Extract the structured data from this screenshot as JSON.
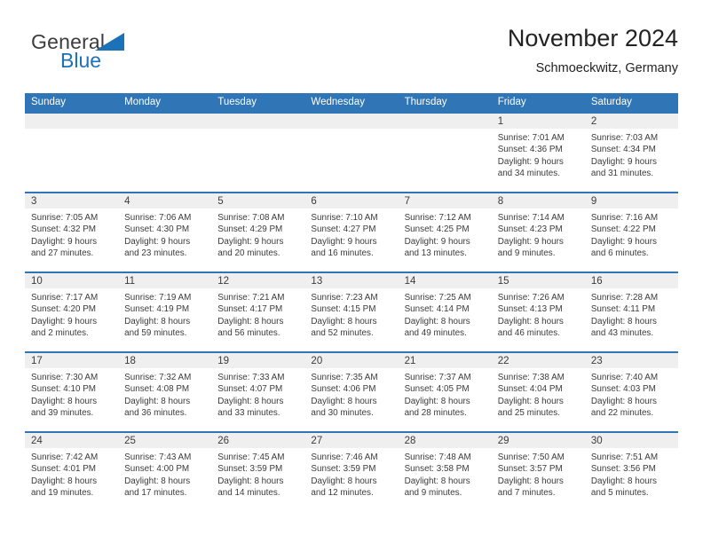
{
  "brand": {
    "word_one": "General",
    "word_two": "Blue",
    "triangle_color": "#1b72b8",
    "text_color": "#3c3c3c"
  },
  "header": {
    "title": "November 2024",
    "subtitle": "Schmoeckwitz, Germany",
    "accent_color": "#3075b5",
    "daynum_band_color": "#efefef"
  },
  "calendar": {
    "weekdays": [
      "Sunday",
      "Monday",
      "Tuesday",
      "Wednesday",
      "Thursday",
      "Friday",
      "Saturday"
    ],
    "weeks": [
      [
        {
          "day": "",
          "lines": []
        },
        {
          "day": "",
          "lines": []
        },
        {
          "day": "",
          "lines": []
        },
        {
          "day": "",
          "lines": []
        },
        {
          "day": "",
          "lines": []
        },
        {
          "day": "1",
          "lines": [
            "Sunrise: 7:01 AM",
            "Sunset: 4:36 PM",
            "Daylight: 9 hours",
            "and 34 minutes."
          ]
        },
        {
          "day": "2",
          "lines": [
            "Sunrise: 7:03 AM",
            "Sunset: 4:34 PM",
            "Daylight: 9 hours",
            "and 31 minutes."
          ]
        }
      ],
      [
        {
          "day": "3",
          "lines": [
            "Sunrise: 7:05 AM",
            "Sunset: 4:32 PM",
            "Daylight: 9 hours",
            "and 27 minutes."
          ]
        },
        {
          "day": "4",
          "lines": [
            "Sunrise: 7:06 AM",
            "Sunset: 4:30 PM",
            "Daylight: 9 hours",
            "and 23 minutes."
          ]
        },
        {
          "day": "5",
          "lines": [
            "Sunrise: 7:08 AM",
            "Sunset: 4:29 PM",
            "Daylight: 9 hours",
            "and 20 minutes."
          ]
        },
        {
          "day": "6",
          "lines": [
            "Sunrise: 7:10 AM",
            "Sunset: 4:27 PM",
            "Daylight: 9 hours",
            "and 16 minutes."
          ]
        },
        {
          "day": "7",
          "lines": [
            "Sunrise: 7:12 AM",
            "Sunset: 4:25 PM",
            "Daylight: 9 hours",
            "and 13 minutes."
          ]
        },
        {
          "day": "8",
          "lines": [
            "Sunrise: 7:14 AM",
            "Sunset: 4:23 PM",
            "Daylight: 9 hours",
            "and 9 minutes."
          ]
        },
        {
          "day": "9",
          "lines": [
            "Sunrise: 7:16 AM",
            "Sunset: 4:22 PM",
            "Daylight: 9 hours",
            "and 6 minutes."
          ]
        }
      ],
      [
        {
          "day": "10",
          "lines": [
            "Sunrise: 7:17 AM",
            "Sunset: 4:20 PM",
            "Daylight: 9 hours",
            "and 2 minutes."
          ]
        },
        {
          "day": "11",
          "lines": [
            "Sunrise: 7:19 AM",
            "Sunset: 4:19 PM",
            "Daylight: 8 hours",
            "and 59 minutes."
          ]
        },
        {
          "day": "12",
          "lines": [
            "Sunrise: 7:21 AM",
            "Sunset: 4:17 PM",
            "Daylight: 8 hours",
            "and 56 minutes."
          ]
        },
        {
          "day": "13",
          "lines": [
            "Sunrise: 7:23 AM",
            "Sunset: 4:15 PM",
            "Daylight: 8 hours",
            "and 52 minutes."
          ]
        },
        {
          "day": "14",
          "lines": [
            "Sunrise: 7:25 AM",
            "Sunset: 4:14 PM",
            "Daylight: 8 hours",
            "and 49 minutes."
          ]
        },
        {
          "day": "15",
          "lines": [
            "Sunrise: 7:26 AM",
            "Sunset: 4:13 PM",
            "Daylight: 8 hours",
            "and 46 minutes."
          ]
        },
        {
          "day": "16",
          "lines": [
            "Sunrise: 7:28 AM",
            "Sunset: 4:11 PM",
            "Daylight: 8 hours",
            "and 43 minutes."
          ]
        }
      ],
      [
        {
          "day": "17",
          "lines": [
            "Sunrise: 7:30 AM",
            "Sunset: 4:10 PM",
            "Daylight: 8 hours",
            "and 39 minutes."
          ]
        },
        {
          "day": "18",
          "lines": [
            "Sunrise: 7:32 AM",
            "Sunset: 4:08 PM",
            "Daylight: 8 hours",
            "and 36 minutes."
          ]
        },
        {
          "day": "19",
          "lines": [
            "Sunrise: 7:33 AM",
            "Sunset: 4:07 PM",
            "Daylight: 8 hours",
            "and 33 minutes."
          ]
        },
        {
          "day": "20",
          "lines": [
            "Sunrise: 7:35 AM",
            "Sunset: 4:06 PM",
            "Daylight: 8 hours",
            "and 30 minutes."
          ]
        },
        {
          "day": "21",
          "lines": [
            "Sunrise: 7:37 AM",
            "Sunset: 4:05 PM",
            "Daylight: 8 hours",
            "and 28 minutes."
          ]
        },
        {
          "day": "22",
          "lines": [
            "Sunrise: 7:38 AM",
            "Sunset: 4:04 PM",
            "Daylight: 8 hours",
            "and 25 minutes."
          ]
        },
        {
          "day": "23",
          "lines": [
            "Sunrise: 7:40 AM",
            "Sunset: 4:03 PM",
            "Daylight: 8 hours",
            "and 22 minutes."
          ]
        }
      ],
      [
        {
          "day": "24",
          "lines": [
            "Sunrise: 7:42 AM",
            "Sunset: 4:01 PM",
            "Daylight: 8 hours",
            "and 19 minutes."
          ]
        },
        {
          "day": "25",
          "lines": [
            "Sunrise: 7:43 AM",
            "Sunset: 4:00 PM",
            "Daylight: 8 hours",
            "and 17 minutes."
          ]
        },
        {
          "day": "26",
          "lines": [
            "Sunrise: 7:45 AM",
            "Sunset: 3:59 PM",
            "Daylight: 8 hours",
            "and 14 minutes."
          ]
        },
        {
          "day": "27",
          "lines": [
            "Sunrise: 7:46 AM",
            "Sunset: 3:59 PM",
            "Daylight: 8 hours",
            "and 12 minutes."
          ]
        },
        {
          "day": "28",
          "lines": [
            "Sunrise: 7:48 AM",
            "Sunset: 3:58 PM",
            "Daylight: 8 hours",
            "and 9 minutes."
          ]
        },
        {
          "day": "29",
          "lines": [
            "Sunrise: 7:50 AM",
            "Sunset: 3:57 PM",
            "Daylight: 8 hours",
            "and 7 minutes."
          ]
        },
        {
          "day": "30",
          "lines": [
            "Sunrise: 7:51 AM",
            "Sunset: 3:56 PM",
            "Daylight: 8 hours",
            "and 5 minutes."
          ]
        }
      ]
    ]
  }
}
